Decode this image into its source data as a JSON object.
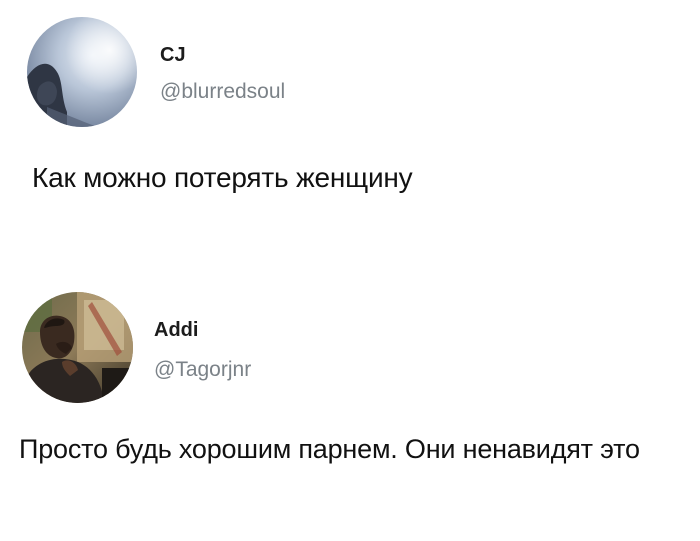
{
  "tweets": [
    {
      "display_name": "CJ",
      "handle": "@blurredsoul",
      "text": "Как можно потерять женщину",
      "avatar_icon": "user-avatar-photo"
    },
    {
      "display_name": "Addi",
      "handle": "@Tagorjnr",
      "text": "Просто будь хорошим парнем. Они ненавидят это",
      "avatar_icon": "user-avatar-photo"
    }
  ]
}
